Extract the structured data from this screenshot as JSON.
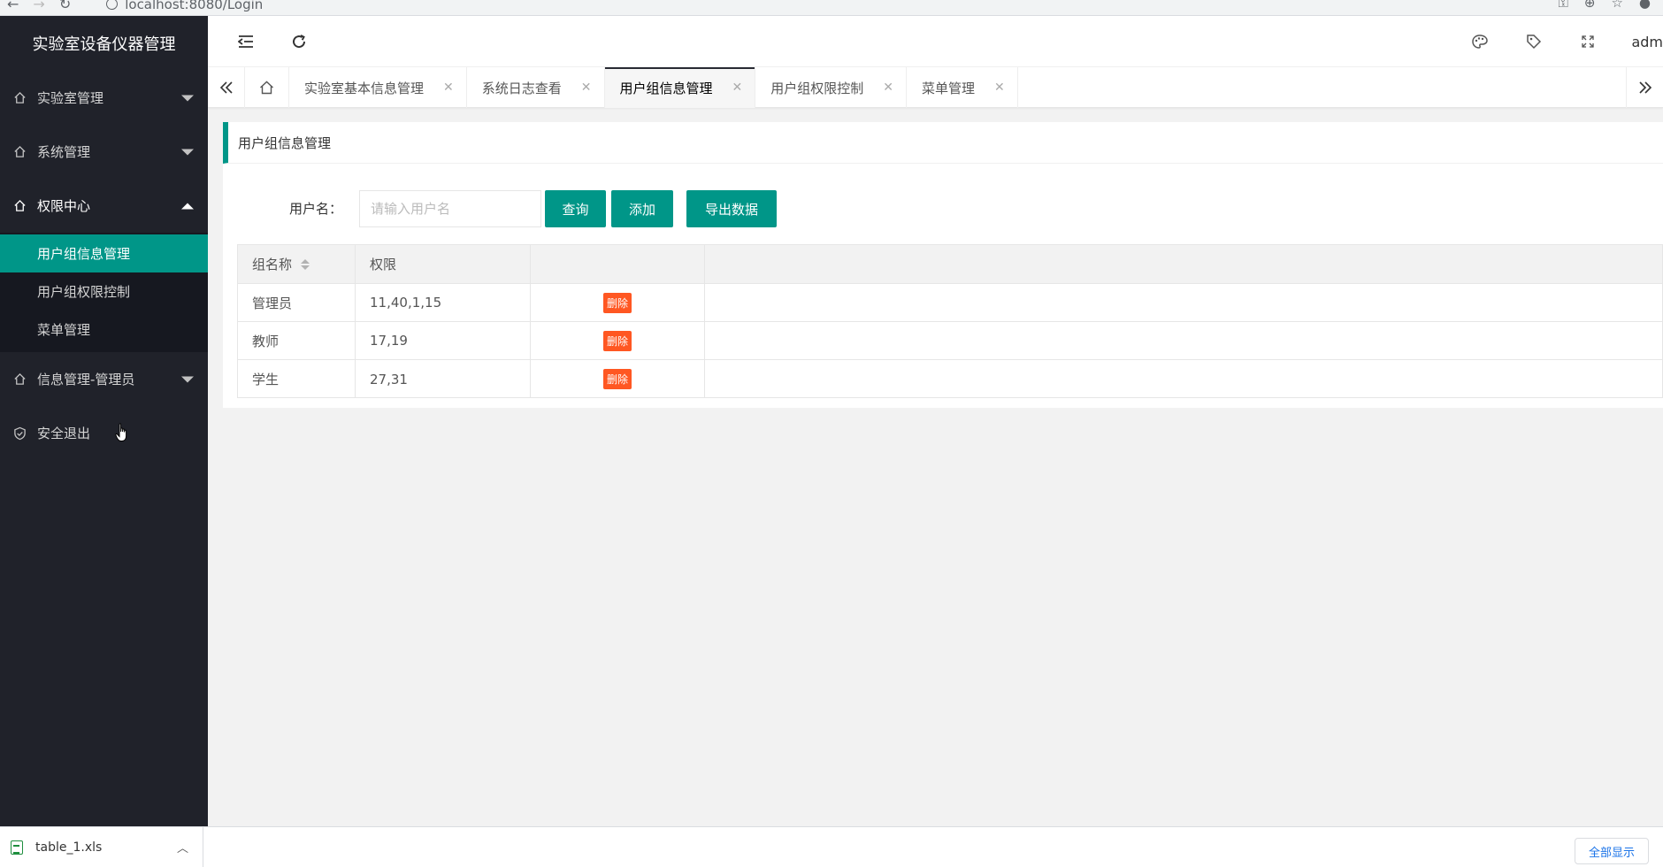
{
  "browser": {
    "url": "localhost:8080/Login"
  },
  "sidebar": {
    "title": "实验室设备仪器管理",
    "menus": [
      {
        "label": "实验室管理",
        "icon": "home-icon",
        "expanded": false
      },
      {
        "label": "系统管理",
        "icon": "home-icon",
        "expanded": false
      },
      {
        "label": "权限中心",
        "icon": "home-icon",
        "expanded": true,
        "children": [
          {
            "label": "用户组信息管理",
            "active": true
          },
          {
            "label": "用户组权限控制",
            "active": false
          },
          {
            "label": "菜单管理",
            "active": false
          }
        ]
      },
      {
        "label": "信息管理-管理员",
        "icon": "home-icon",
        "expanded": false
      },
      {
        "label": "安全退出",
        "icon": "shield-check-icon",
        "expanded": false
      }
    ]
  },
  "header": {
    "user": "adm",
    "icons": [
      "menu-fold-icon",
      "refresh-icon",
      "palette-icon",
      "tag-icon",
      "fullscreen-icon"
    ]
  },
  "tabs": [
    {
      "label": "实验室基本信息管理",
      "active": false
    },
    {
      "label": "系统日志查看",
      "active": false
    },
    {
      "label": "用户组信息管理",
      "active": true
    },
    {
      "label": "用户组权限控制",
      "active": false
    },
    {
      "label": "菜单管理",
      "active": false
    }
  ],
  "panel": {
    "title": "用户组信息管理",
    "search_label": "用户名：",
    "search_placeholder": "请输入用户名",
    "search_value": "",
    "btn_query": "查询",
    "btn_add": "添加",
    "btn_export": "导出数据"
  },
  "table": {
    "columns": [
      "组名称",
      "权限",
      ""
    ],
    "rows": [
      {
        "name": "管理员",
        "perm": "11,40,1,15",
        "action": "删除"
      },
      {
        "name": "教师",
        "perm": "17,19",
        "action": "删除"
      },
      {
        "name": "学生",
        "perm": "27,31",
        "action": "删除"
      }
    ]
  },
  "colors": {
    "accent": "#009688",
    "sidebar_bg": "#20222a",
    "danger": "#ff5722"
  },
  "download": {
    "file": "table_1.xls",
    "show_all": "全部显示"
  }
}
